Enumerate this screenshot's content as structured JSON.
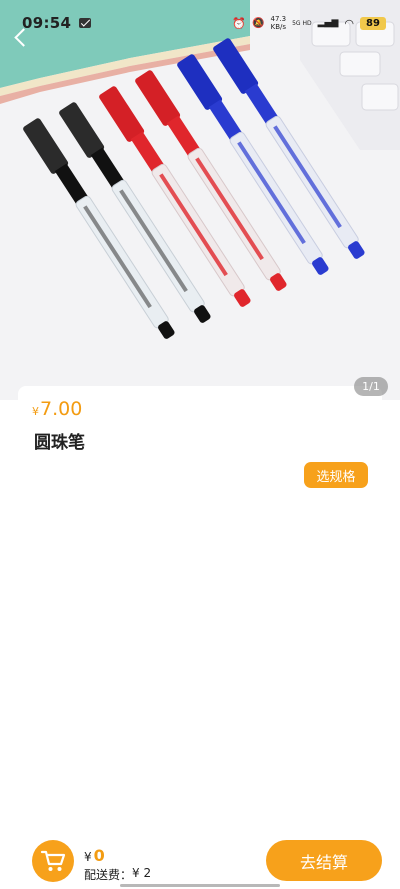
{
  "status_bar": {
    "time": "09:54",
    "net_speed_value": "47.3",
    "net_speed_unit": "KB/s",
    "signal_label": "5G HD",
    "battery": "89"
  },
  "gallery": {
    "page_indicator": "1/1"
  },
  "product": {
    "price_symbol": "¥",
    "price": "7.00",
    "name": "圆珠笔",
    "spec_button_label": "选规格"
  },
  "cart": {
    "total_symbol": "¥",
    "total": "0",
    "delivery_fee_label": "配送费：",
    "delivery_fee_value": "¥ 2",
    "checkout_label": "去结算"
  },
  "colors": {
    "accent": "#f7a11b",
    "price": "#f39c12",
    "pen_black": "#1b1b1b",
    "pen_red": "#e0262c",
    "pen_blue": "#2a3bd0"
  }
}
